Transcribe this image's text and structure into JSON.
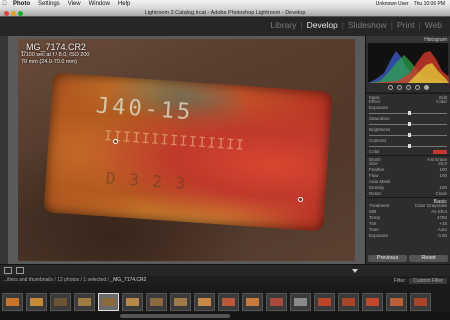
{
  "menubar": {
    "items": [
      "Photo",
      "Settings",
      "View",
      "Window",
      "Help"
    ],
    "right": [
      "Unknown User",
      "Thu 10:06 PM"
    ]
  },
  "window": {
    "title": "Lightroom 2 Catalog.lrcat - Adobe Photoshop Lightroom - Develop"
  },
  "modules": [
    "Library",
    "Develop",
    "Slideshow",
    "Print",
    "Web"
  ],
  "active_module": "Develop",
  "photo": {
    "filename": "_MG_7174.CR2",
    "exposure": "1/100 sec at f / 8.0, ISO 200",
    "lens": "70 mm (24.0-70.0 mm)",
    "stamp_line1": "J40-15",
    "stamp_line2": "IIIIIIIIIIIIIII",
    "stamp_line3": "D 3 2 3"
  },
  "right_panel": {
    "histogram_label": "Histogram",
    "rows": [
      {
        "label": "Mask",
        "value": "Edit"
      },
      {
        "label": "Effect",
        "value": "Color"
      },
      {
        "label": "Exposure",
        "value": ""
      },
      {
        "label": "Saturation",
        "value": ""
      },
      {
        "label": "Brightness",
        "value": ""
      },
      {
        "label": "Contrast",
        "value": ""
      },
      {
        "label": "Color",
        "value": ""
      },
      {
        "label": "Brush",
        "value": "A  B  Erase"
      },
      {
        "label": "Size",
        "value": "20.0"
      },
      {
        "label": "Feather",
        "value": "100"
      },
      {
        "label": "Flow",
        "value": "100"
      },
      {
        "label": "Auto Mask",
        "value": ""
      },
      {
        "label": "Density",
        "value": "100"
      },
      {
        "label": "Reset",
        "value": "Close"
      },
      {
        "label": "Basic",
        "value": ""
      },
      {
        "label": "Treatment",
        "value": "Color  Grayscale"
      },
      {
        "label": "WB",
        "value": "As Shot"
      },
      {
        "label": "Temp",
        "value": "4750"
      },
      {
        "label": "Tint",
        "value": "+15"
      },
      {
        "label": "Tone",
        "value": "Auto"
      },
      {
        "label": "Exposure",
        "value": "0.00"
      }
    ],
    "previous_label": "Previous",
    "reset_label": "Reset"
  },
  "filmstrip_header": {
    "text": "...ilters and thumbnails / 12 photos / 1 selected /",
    "filename": "_MG_7174.CR2",
    "filter_label": "Filter:",
    "filter_value": "Custom Filter"
  },
  "thumbnails": [
    {
      "color": "#c8742a"
    },
    {
      "color": "#c48a3a"
    },
    {
      "color": "#6c5436"
    },
    {
      "color": "#a27a44"
    },
    {
      "color": "#8a6a3a"
    },
    {
      "color": "#b8884a"
    },
    {
      "color": "#8a6a40"
    },
    {
      "color": "#a07a48"
    },
    {
      "color": "#c8884a"
    },
    {
      "color": "#b85a3a"
    },
    {
      "color": "#c87a3a"
    },
    {
      "color": "#a84a3a"
    },
    {
      "color": "#8a8a8a"
    },
    {
      "color": "#b8442a"
    },
    {
      "color": "#a8442a"
    },
    {
      "color": "#c04a30"
    },
    {
      "color": "#b8603a"
    },
    {
      "color": "#a8442a"
    }
  ]
}
